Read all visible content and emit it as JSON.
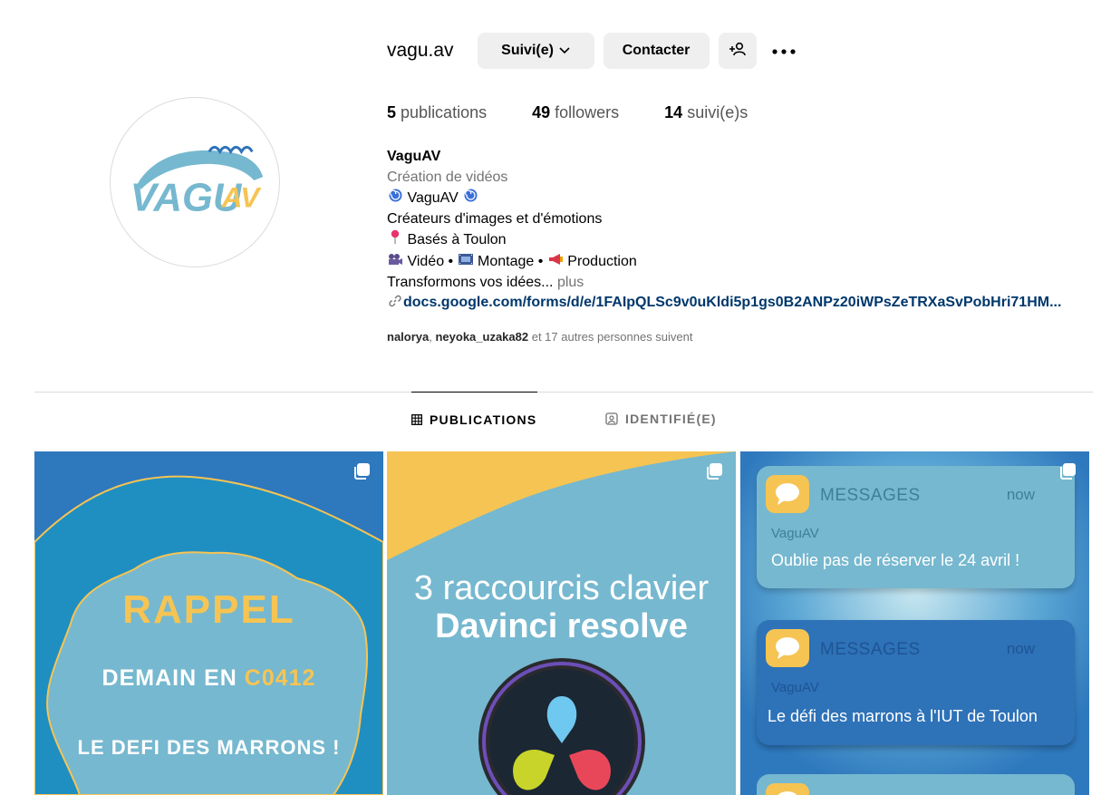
{
  "profile": {
    "username": "vagu.av",
    "avatar_text": "VAGUAV",
    "buttons": {
      "follow": "Suivi(e)",
      "contact": "Contacter"
    },
    "stats": {
      "posts_count": "5",
      "posts_label": "publications",
      "followers_count": "49",
      "followers_label": "followers",
      "following_count": "14",
      "following_label": "suivi(e)s"
    },
    "bio": {
      "name": "VaguAV",
      "category": "Création de vidéos",
      "line1": "VaguAV",
      "line2": "Créateurs d'images et d'émotions",
      "line3": "Basés à Toulon",
      "line4_a": "Vidéo •",
      "line4_b": "Montage •",
      "line4_c": "Production",
      "line5": "Transformons vos idées...",
      "more": "plus",
      "link": "docs.google.com/forms/d/e/1FAIpQLSc9v0uKldi5p1gs0B2ANPz20iWPsZeTRXaSvPobHri71HM..."
    },
    "followed_by": {
      "user1": "nalorya",
      "sep": ", ",
      "user2": "neyoka_uzaka82",
      "rest": " et 17 autres personnes suivent"
    }
  },
  "tabs": [
    {
      "label": "PUBLICATIONS",
      "active": true
    },
    {
      "label": "IDENTIFIÉ(E)",
      "active": false
    }
  ],
  "posts": [
    {
      "title": "RAPPEL",
      "line_a": "DEMAIN EN ",
      "line_code": "C0412",
      "line_b": "LE DEFI DES MARRONS !"
    },
    {
      "title_line1": "3 raccourcis clavier",
      "title_line2": "Davinci resolve"
    },
    {
      "notifications": [
        {
          "app": "MESSAGES",
          "time": "now",
          "from": "VaguAV",
          "message": "Oublie pas de réserver le 24 avril !"
        },
        {
          "app": "MESSAGES",
          "time": "now",
          "from": "VaguAV",
          "message": "Le défi des marrons à l'IUT de Toulon"
        }
      ]
    }
  ],
  "colors": {
    "link": "#00376b",
    "muted": "#737373",
    "button_bg": "#efefef",
    "brand_blue": "#76b8cf",
    "brand_yellow": "#f6c453",
    "deep_blue": "#2e72b8"
  }
}
